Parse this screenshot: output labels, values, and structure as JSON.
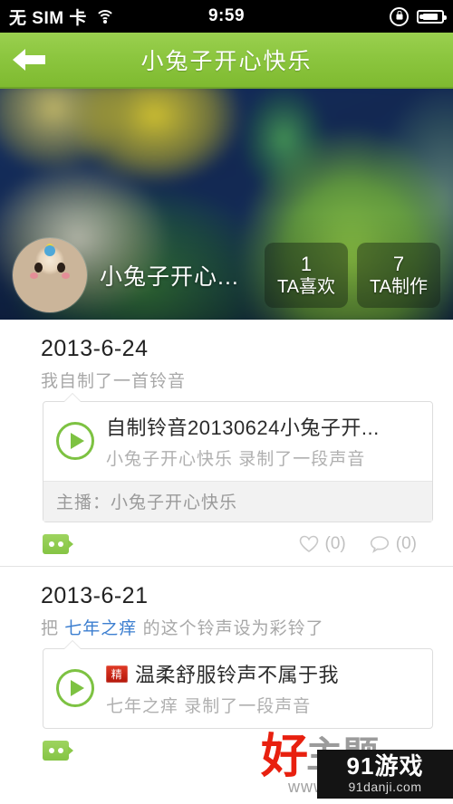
{
  "status_bar": {
    "carrier": "无 SIM 卡",
    "wifi_icon": "wifi-icon",
    "time": "9:59",
    "rotation_lock_icon": "rotation-lock-icon",
    "battery_icon": "battery-charging-icon"
  },
  "nav": {
    "back_icon": "back-arrow-icon",
    "title": "小兔子开心快乐"
  },
  "profile": {
    "avatar_icon": "user-avatar",
    "name": "小兔子开心...",
    "stats": [
      {
        "value": "1",
        "label": "TA喜欢"
      },
      {
        "value": "7",
        "label": "TA制作"
      }
    ]
  },
  "feed": [
    {
      "date": "2013-6-24",
      "desc_prefix": "我自制了一首铃音",
      "desc_link": "",
      "desc_suffix": "",
      "card": {
        "play_icon": "play-icon",
        "badge": "",
        "title": "自制铃音20130624小兔子开...",
        "subtitle": "小兔子开心快乐 录制了一段声音",
        "footer": "主播：小兔子开心快乐"
      },
      "actions": {
        "comment_icon": "speech-bubble-icon",
        "like_icon": "heart-icon",
        "like_count": "(0)",
        "reply_icon": "comment-icon",
        "reply_count": "(0)"
      }
    },
    {
      "date": "2013-6-21",
      "desc_prefix": "把 ",
      "desc_link": "七年之痒",
      "desc_suffix": " 的这个铃声设为彩铃了",
      "card": {
        "play_icon": "play-icon",
        "badge": "精",
        "title": "温柔舒服铃声不属于我",
        "subtitle": "七年之痒 录制了一段声音",
        "footer": ""
      },
      "actions": {
        "comment_icon": "speech-bubble-icon",
        "like_icon": "heart-icon",
        "like_count": "",
        "reply_icon": "comment-icon",
        "reply_count": ""
      }
    }
  ],
  "watermarks": {
    "hao_text": "好",
    "zhuti_text": "主题",
    "www_text": "www.",
    "danji_title": "91游戏",
    "danji_url": "91danji.com"
  },
  "colors": {
    "nav_green": "#8cc63f",
    "accent_green": "#7dc242",
    "link_blue": "#3d7fd0",
    "badge_red": "#c4190c"
  }
}
